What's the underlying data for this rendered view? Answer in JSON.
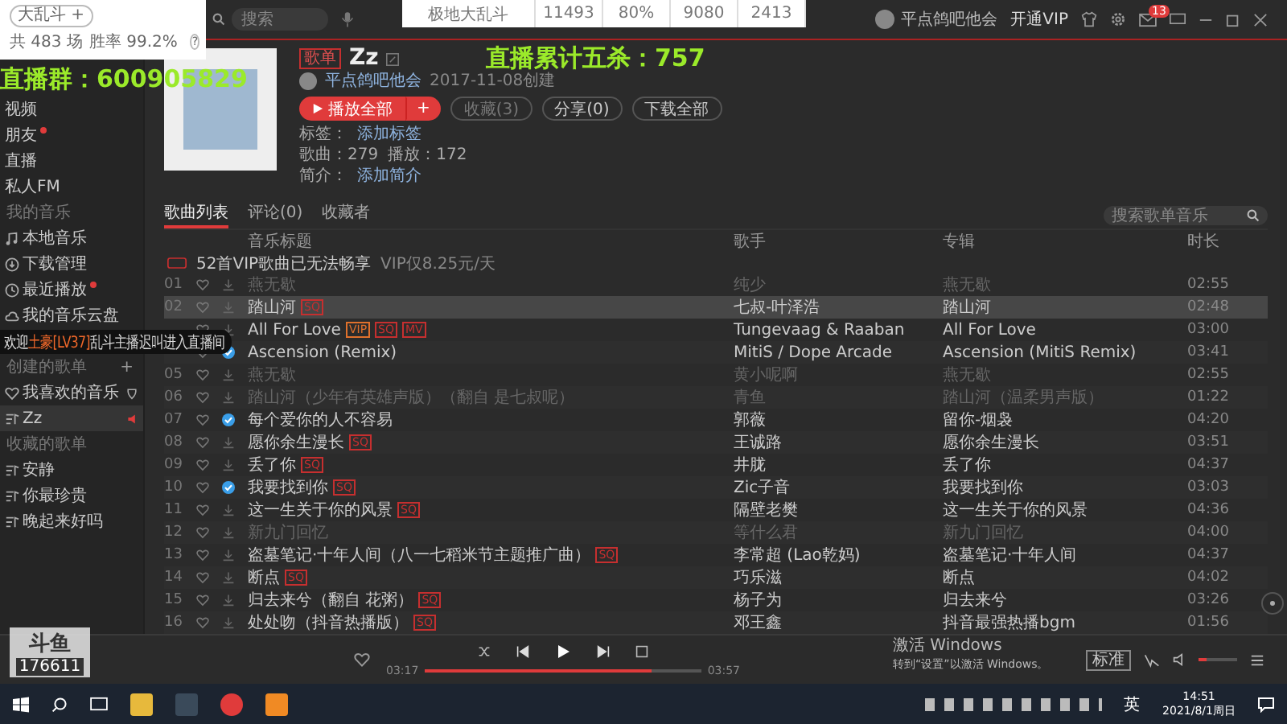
{
  "titlebar": {
    "search": {
      "placeholder": "搜索"
    },
    "user": "平点鸽吧他会",
    "vip": "开通VIP",
    "mail_count": "13"
  },
  "sidebar": [
    {
      "kind": "nav",
      "label": "视频",
      "badge": false,
      "selected": false
    },
    {
      "kind": "nav",
      "label": "朋友",
      "badge": true,
      "selected": false
    },
    {
      "kind": "nav",
      "label": "直播",
      "badge": false,
      "selected": false
    },
    {
      "kind": "nav",
      "label": "私人FM",
      "badge": false,
      "selected": false
    },
    {
      "kind": "header",
      "label": "我的音乐"
    },
    {
      "kind": "local",
      "label": "本地音乐",
      "badge": false,
      "selected": false
    },
    {
      "kind": "download",
      "label": "下载管理",
      "badge": false,
      "selected": false
    },
    {
      "kind": "recent",
      "label": "最近播放",
      "badge": true,
      "selected": false
    },
    {
      "kind": "cloud",
      "label": "我的音乐云盘",
      "badge": false,
      "selected": false
    },
    {
      "kind": "header",
      "label": "创建的歌单",
      "action": "+"
    },
    {
      "kind": "liked",
      "label": "我喜欢的音乐",
      "badge": false,
      "selected": false
    },
    {
      "kind": "playlist",
      "label": "Zz",
      "badge": false,
      "selected": true
    },
    {
      "kind": "header",
      "label": "收藏的歌单"
    },
    {
      "kind": "playlist",
      "label": "安静",
      "badge": false,
      "selected": false
    },
    {
      "kind": "playlist",
      "label": "你最珍贵",
      "badge": false,
      "selected": false
    },
    {
      "kind": "playlist",
      "label": "晚起来好吗",
      "badge": false,
      "selected": false
    }
  ],
  "playlist": {
    "tag": "歌单",
    "title": "Zz",
    "creator": "平点鸽吧他会",
    "created": "2017-11-08创建",
    "buttons": {
      "play_all": "播放全部",
      "add": "+",
      "collect": "收藏(3)",
      "share": "分享(0)",
      "download": "下载全部"
    },
    "tags_label": "标签：",
    "tags_value": "添加标签",
    "songs": "歌曲：279",
    "plays": "播放：172",
    "intro_label": "简介：",
    "intro_value": "添加简介"
  },
  "tabs": [
    {
      "label": "歌曲列表",
      "selected": true
    },
    {
      "label": "评论(0)",
      "selected": false
    },
    {
      "label": "收藏者",
      "selected": false
    }
  ],
  "list_search": {
    "placeholder": "搜索歌单音乐"
  },
  "columns": [
    "音乐标题",
    "歌手",
    "专辑",
    "时长"
  ],
  "notice": {
    "text": "52首VIP歌曲已无法畅享",
    "price": "VIP仅8.25元/天"
  },
  "songs": [
    {
      "num": "01",
      "title": "燕无歇",
      "singer": "纯少",
      "album": "燕无歇",
      "duration": "02:55",
      "unavailable": true,
      "downloaded": false,
      "highlighted": false
    },
    {
      "num": "02",
      "title": "踏山河",
      "tags": [
        {
          "label": "SQ",
          "color": "#c62f2f"
        }
      ],
      "singer": "七叔-叶泽浩",
      "album": "踏山河",
      "duration": "02:48",
      "unavailable": false,
      "downloaded": false,
      "highlighted": true
    },
    {
      "title": "All For Love",
      "tags": [
        {
          "label": "VIP",
          "color": "#e0712c"
        },
        {
          "label": "SQ",
          "color": "#c62f2f"
        },
        {
          "label": "MV",
          "color": "#c62f2f"
        }
      ],
      "singer": "Tungevaag & Raaban",
      "album": "All For Love",
      "duration": "03:00",
      "unavailable": false,
      "downloaded": false,
      "highlighted": false
    },
    {
      "title": "Ascension (Remix)",
      "singer": "MitiS / Dope Arcade",
      "album": "Ascension (MitiS Remix)",
      "duration": "03:41",
      "unavailable": false,
      "downloaded": true,
      "highlighted": false
    },
    {
      "num": "05",
      "title": "燕无歇",
      "singer": "黄小呢啊",
      "album": "燕无歇",
      "duration": "02:55",
      "unavailable": true,
      "downloaded": false,
      "highlighted": false
    },
    {
      "num": "06",
      "title": "踏山河（少年有英雄声版）（翻自 是七叔呢）",
      "singer": "青鱼",
      "album": "踏山河（温柔男声版）",
      "duration": "01:22",
      "unavailable": true,
      "downloaded": false,
      "highlighted": false
    },
    {
      "num": "07",
      "title": "每个爱你的人不容易",
      "singer": "郭薇",
      "album": "留你-烟袅",
      "duration": "04:20",
      "unavailable": false,
      "downloaded": true,
      "highlighted": false
    },
    {
      "num": "08",
      "title": "愿你余生漫长",
      "tags": [
        {
          "label": "SQ",
          "color": "#c62f2f"
        }
      ],
      "singer": "王诚路",
      "album": "愿你余生漫长",
      "duration": "03:51",
      "unavailable": false,
      "downloaded": false,
      "highlighted": false
    },
    {
      "num": "09",
      "title": "丢了你",
      "tags": [
        {
          "label": "SQ",
          "color": "#c62f2f"
        }
      ],
      "singer": "井胧",
      "album": "丢了你",
      "duration": "04:37",
      "unavailable": false,
      "downloaded": false,
      "highlighted": false
    },
    {
      "num": "10",
      "title": "我要找到你",
      "tags": [
        {
          "label": "SQ",
          "color": "#c62f2f"
        }
      ],
      "singer": "Zic子音",
      "album": "我要找到你",
      "duration": "03:03",
      "unavailable": false,
      "downloaded": true,
      "highlighted": false
    },
    {
      "num": "11",
      "title": "这一生关于你的风景",
      "tags": [
        {
          "label": "SQ",
          "color": "#c62f2f"
        }
      ],
      "singer": "隔壁老樊",
      "album": "这一生关于你的风景",
      "duration": "04:36",
      "unavailable": false,
      "downloaded": false,
      "highlighted": false
    },
    {
      "num": "12",
      "title": "新九门回忆",
      "singer": "等什么君",
      "album": "新九门回忆",
      "duration": "04:00",
      "unavailable": true,
      "downloaded": false,
      "highlighted": false
    },
    {
      "num": "13",
      "title": "盗墓笔记·十年人间（八一七稻米节主题推广曲）",
      "tags": [
        {
          "label": "SQ",
          "color": "#c62f2f"
        }
      ],
      "singer": "李常超 (Lao乾妈)",
      "album": "盗墓笔记·十年人间",
      "duration": "04:37",
      "unavailable": false,
      "downloaded": false,
      "highlighted": false
    },
    {
      "num": "14",
      "title": "断点",
      "tags": [
        {
          "label": "SQ",
          "color": "#c62f2f"
        }
      ],
      "singer": "巧乐滋",
      "album": "断点",
      "duration": "04:02",
      "unavailable": false,
      "downloaded": false,
      "highlighted": false
    },
    {
      "num": "15",
      "title": "归去来兮（翻自 花粥）",
      "tags": [
        {
          "label": "SQ",
          "color": "#c62f2f"
        }
      ],
      "singer": "杨子为",
      "album": "归去来兮",
      "duration": "03:26",
      "unavailable": false,
      "downloaded": false,
      "highlighted": false
    },
    {
      "num": "16",
      "title": "处处吻（抖音热播版）",
      "tags": [
        {
          "label": "SQ",
          "color": "#c62f2f"
        }
      ],
      "singer": "邓王鑫",
      "album": "抖音最强热播bgm",
      "duration": "01:56",
      "unavailable": false,
      "downloaded": false,
      "highlighted": false
    }
  ],
  "player": {
    "liked": false,
    "current": "03:17",
    "total": "03:57",
    "progress": {
      "level": 0.82
    },
    "quality": "标准",
    "volume": {
      "level": 0.2
    }
  },
  "activation": {
    "title": "激活 Windows",
    "hint": "转到“设置”以激活 Windows。"
  },
  "taskbar": {
    "ime": "英",
    "time": "14:51",
    "date": "2021/8/1周日"
  },
  "overlays": {
    "stats_card": {
      "tag": "大乱斗",
      "tag_action": "+",
      "games": "共 483 场",
      "win_rate": "胜率 99.2%",
      "help": "?"
    },
    "stats_table": [
      "极地大乱斗",
      "11493",
      "80%",
      "9080",
      "2413"
    ],
    "group_text": "直播群：600905829",
    "pentakill_text": "直播累计五杀：757",
    "chat": {
      "prefix": "欢迎",
      "user": "土豪[LV37]",
      "suffix": "乱斗主播迟叫进入直播间"
    },
    "stream_logo": {
      "name": "斗鱼",
      "room": "176611"
    }
  }
}
